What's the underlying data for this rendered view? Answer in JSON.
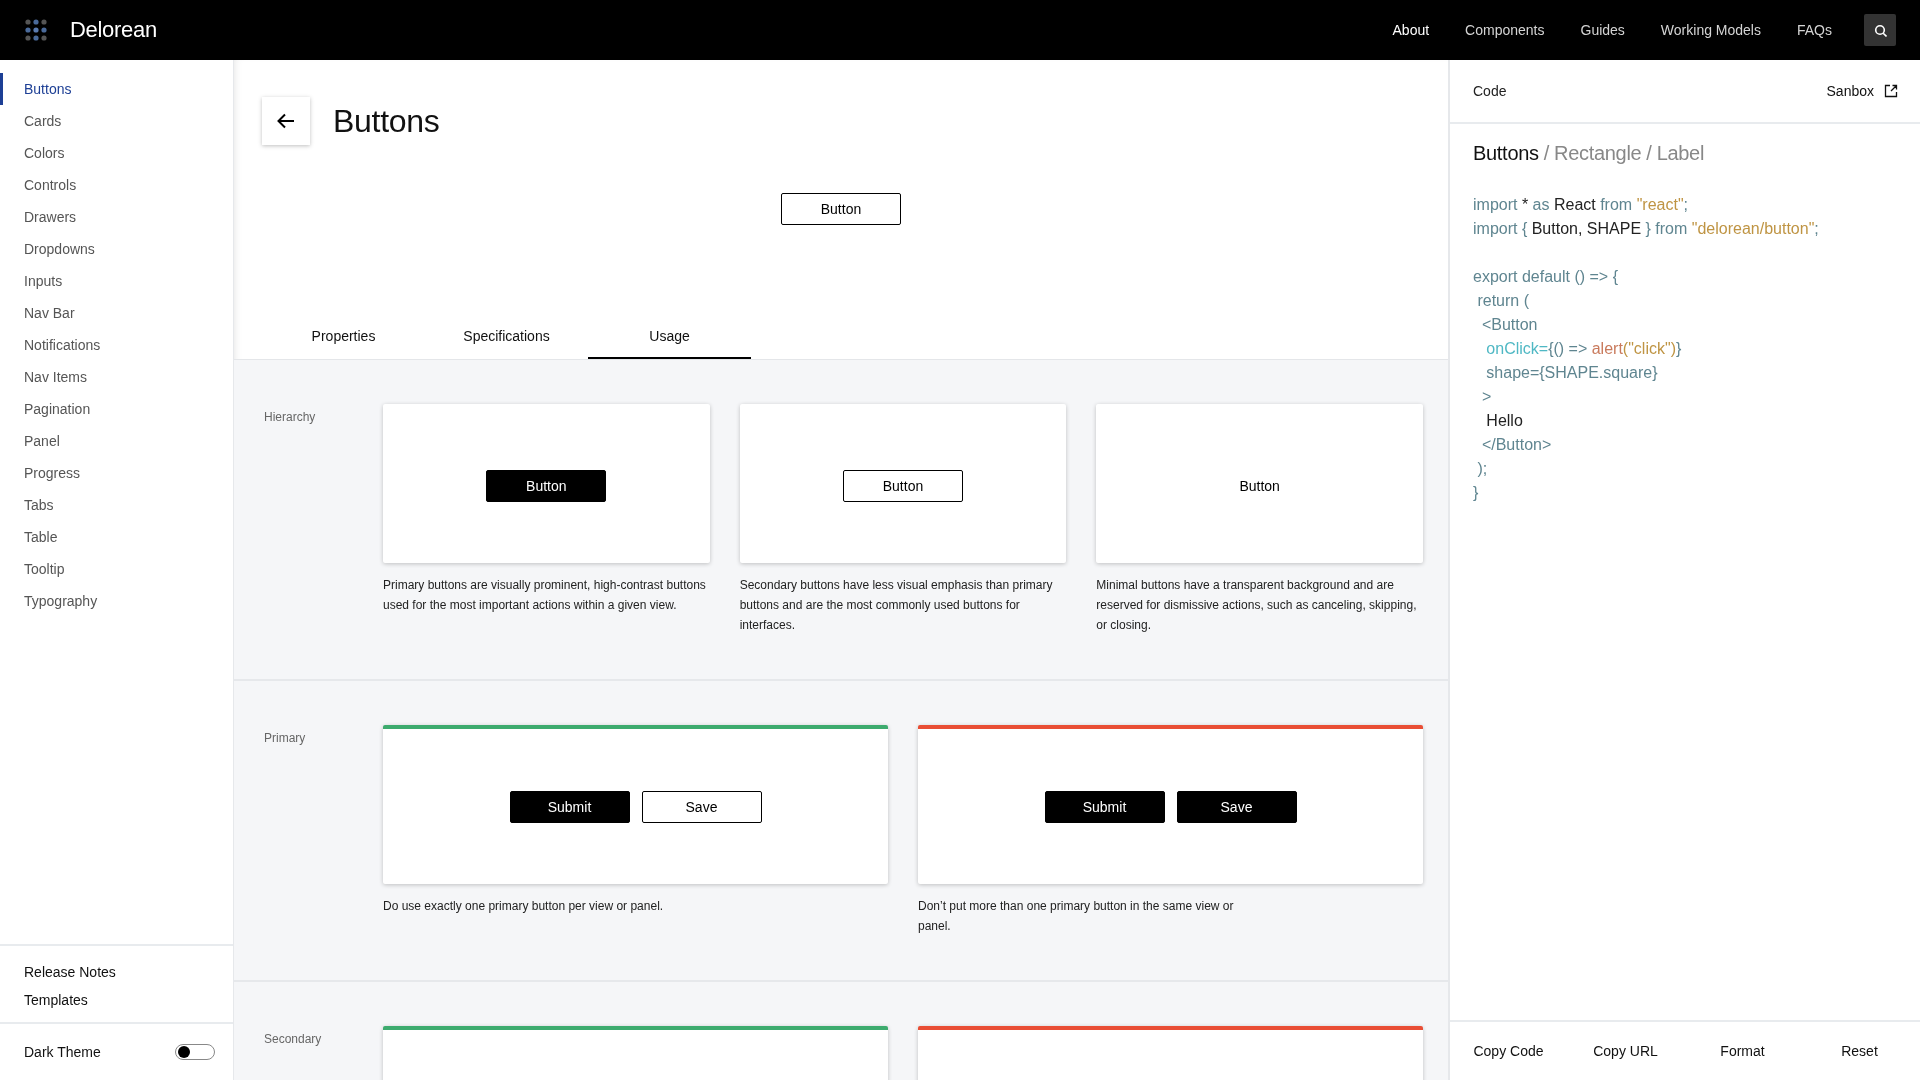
{
  "header": {
    "logo": "Delorean",
    "nav": [
      {
        "label": "About",
        "selected": true
      },
      {
        "label": "Components",
        "selected": false
      },
      {
        "label": "Guides",
        "selected": false
      },
      {
        "label": "Working Models",
        "selected": false
      },
      {
        "label": "FAQs",
        "selected": false
      }
    ]
  },
  "sidebar": {
    "items": [
      {
        "label": "Buttons",
        "selected": true
      },
      {
        "label": "Cards",
        "selected": false
      },
      {
        "label": "Colors",
        "selected": false
      },
      {
        "label": "Controls",
        "selected": false
      },
      {
        "label": "Drawers",
        "selected": false
      },
      {
        "label": "Dropdowns",
        "selected": false
      },
      {
        "label": "Inputs",
        "selected": false
      },
      {
        "label": "Nav Bar",
        "selected": false
      },
      {
        "label": "Notifications",
        "selected": false
      },
      {
        "label": "Nav Items",
        "selected": false
      },
      {
        "label": "Pagination",
        "selected": false
      },
      {
        "label": "Panel",
        "selected": false
      },
      {
        "label": "Progress",
        "selected": false
      },
      {
        "label": "Tabs",
        "selected": false
      },
      {
        "label": "Table",
        "selected": false
      },
      {
        "label": "Tooltip",
        "selected": false
      },
      {
        "label": "Typography",
        "selected": false
      }
    ],
    "footer_links": [
      "Release Notes",
      "Templates"
    ],
    "theme_toggle": {
      "label": "Dark Theme",
      "on": false
    }
  },
  "page": {
    "title": "Buttons",
    "demo_button": {
      "label": "Button",
      "kind": "secondary"
    },
    "tabs": [
      {
        "label": "Properties",
        "selected": false
      },
      {
        "label": "Specifications",
        "selected": false
      },
      {
        "label": "Usage",
        "selected": true
      }
    ],
    "sections": [
      {
        "label": "Hierarchy",
        "cards": [
          {
            "buttons": [
              {
                "label": "Button",
                "kind": "primary"
              }
            ],
            "description": "Primary buttons are visually prominent, high-contrast buttons used for the most important actions within a given view."
          },
          {
            "buttons": [
              {
                "label": "Button",
                "kind": "secondary"
              }
            ],
            "description": "Secondary buttons have less visual emphasis than primary buttons and are the most commonly used buttons for interfaces."
          },
          {
            "buttons": [
              {
                "label": "Button",
                "kind": "minimal"
              }
            ],
            "description": "Minimal buttons have a transparent background and are reserved for dismissive actions, such as canceling, skipping, or closing."
          }
        ]
      },
      {
        "label": "Primary",
        "cards": [
          {
            "color": "#3dab6e",
            "buttons": [
              {
                "label": "Submit",
                "kind": "primary"
              },
              {
                "label": "Save",
                "kind": "secondary"
              }
            ],
            "description": "Do use exactly one primary button per view or panel."
          },
          {
            "color": "#e94e35",
            "buttons": [
              {
                "label": "Submit",
                "kind": "primary"
              },
              {
                "label": "Save",
                "kind": "primary"
              }
            ],
            "description": "Don’t put more than one primary button in the same view or panel."
          }
        ]
      },
      {
        "label": "Secondary",
        "cards": [
          {
            "color": "#3dab6e"
          },
          {
            "color": "#e94e35"
          }
        ]
      }
    ]
  },
  "code_panel": {
    "title": "Code",
    "sandbox_link": "Sanbox",
    "breadcrumb": [
      {
        "text": "Buttons",
        "kind": "current"
      },
      {
        "text": "/",
        "kind": "separator"
      },
      {
        "text": "Rectangle",
        "kind": "ancestor"
      },
      {
        "text": "/",
        "kind": "separator"
      },
      {
        "text": "Label",
        "kind": "ancestor"
      }
    ],
    "code_lines": [
      {
        "kind": "code",
        "tokens": [
          {
            "text": "import ",
            "kind": "keyword"
          },
          {
            "text": "* ",
            "kind": "plain"
          },
          {
            "text": "as ",
            "kind": "keyword"
          },
          {
            "text": "React ",
            "kind": "plain"
          },
          {
            "text": "from ",
            "kind": "keyword"
          },
          {
            "text": "\"react\"",
            "kind": "string"
          },
          {
            "text": ";",
            "kind": "keyword"
          }
        ]
      },
      {
        "kind": "code",
        "tokens": [
          {
            "text": "import { ",
            "kind": "keyword"
          },
          {
            "text": "Button, SHAPE ",
            "kind": "plain"
          },
          {
            "text": "} from ",
            "kind": "keyword"
          },
          {
            "text": "\"delorean/button\"",
            "kind": "string"
          },
          {
            "text": ";",
            "kind": "keyword"
          }
        ]
      },
      {
        "kind": "blank"
      },
      {
        "kind": "code",
        "tokens": [
          {
            "text": "export default () => {",
            "kind": "keyword"
          }
        ]
      },
      {
        "kind": "code",
        "tokens": [
          {
            "text": " return (",
            "kind": "keyword"
          }
        ]
      },
      {
        "kind": "code",
        "tokens": [
          {
            "text": "  <Button",
            "kind": "keyword"
          }
        ]
      },
      {
        "kind": "code",
        "tokens": [
          {
            "text": "   onClick=",
            "kind": "attribute"
          },
          {
            "text": "{() => ",
            "kind": "keyword"
          },
          {
            "text": "alert",
            "kind": "function"
          },
          {
            "text": "(\"click\")",
            "kind": "string"
          },
          {
            "text": "}",
            "kind": "keyword"
          }
        ]
      },
      {
        "kind": "code",
        "tokens": [
          {
            "text": "   shape={SHAPE.square}",
            "kind": "keyword"
          }
        ]
      },
      {
        "kind": "code",
        "tokens": [
          {
            "text": "  >",
            "kind": "keyword"
          }
        ]
      },
      {
        "kind": "code",
        "tokens": [
          {
            "text": "   Hello",
            "kind": "plain"
          }
        ]
      },
      {
        "kind": "code",
        "tokens": [
          {
            "text": "  </Button>",
            "kind": "keyword"
          }
        ]
      },
      {
        "kind": "code",
        "tokens": [
          {
            "text": " );",
            "kind": "keyword"
          }
        ]
      },
      {
        "kind": "code",
        "tokens": [
          {
            "text": "}",
            "kind": "keyword"
          }
        ]
      }
    ],
    "actions": [
      "Copy Code",
      "Copy URL",
      "Format",
      "Reset"
    ]
  }
}
